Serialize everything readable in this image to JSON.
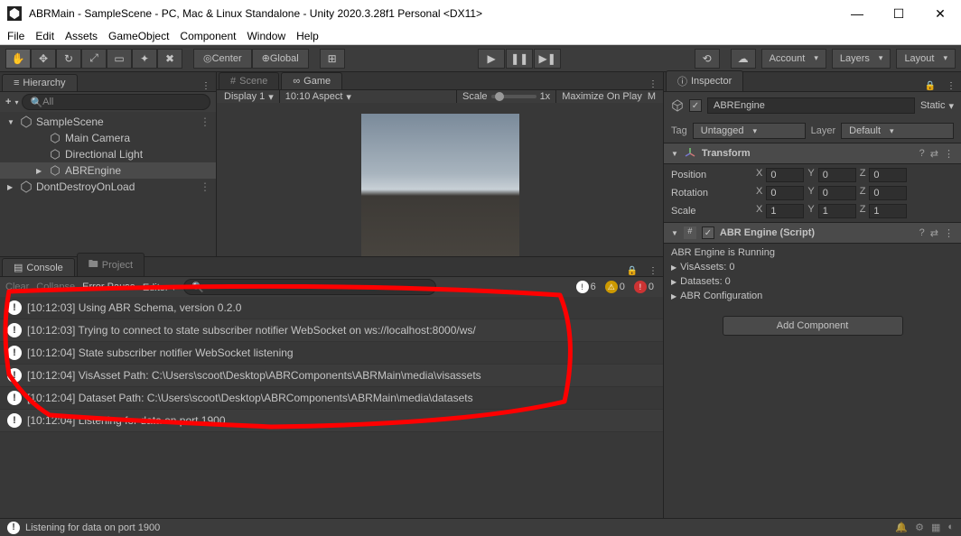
{
  "titlebar": {
    "title": "ABRMain - SampleScene - PC, Mac & Linux Standalone - Unity 2020.3.28f1 Personal <DX11>"
  },
  "menu": [
    "File",
    "Edit",
    "Assets",
    "GameObject",
    "Component",
    "Window",
    "Help"
  ],
  "toolbar": {
    "center_label": "Center",
    "global_label": "Global",
    "account_label": "Account",
    "layers_label": "Layers",
    "layout_label": "Layout"
  },
  "hierarchy": {
    "tab": "Hierarchy",
    "add_label": "+",
    "search_placeholder": "All",
    "items": [
      {
        "label": "SampleScene",
        "type": "scene",
        "expanded": true,
        "indent": 0
      },
      {
        "label": "Main Camera",
        "type": "go",
        "indent": 2
      },
      {
        "label": "Directional Light",
        "type": "go",
        "indent": 2
      },
      {
        "label": "ABREngine",
        "type": "go",
        "indent": 2,
        "selected": true,
        "hasArrow": true
      },
      {
        "label": "DontDestroyOnLoad",
        "type": "scene",
        "expanded": false,
        "indent": 0
      }
    ]
  },
  "scene_tab": "Scene",
  "game_tab": "Game",
  "game_toolbar": {
    "display": "Display 1",
    "aspect": "10:10 Aspect",
    "scale_label": "Scale",
    "scale_value": "1x",
    "maximize": "Maximize On Play",
    "mute": "M"
  },
  "console": {
    "tab": "Console",
    "project_tab": "Project",
    "clear": "Clear",
    "collapse": "Collapse",
    "error_pause": "Error Pause",
    "editor": "Editor",
    "info_count": "6",
    "warn_count": "0",
    "error_count": "0",
    "items": [
      {
        "text": "[10:12:03] Using ABR Schema, version 0.2.0"
      },
      {
        "text": "[10:12:03] Trying to connect to state subscriber notifier WebSocket on ws://localhost:8000/ws/"
      },
      {
        "text": "[10:12:04] State subscriber notifier WebSocket listening"
      },
      {
        "text": "[10:12:04] VisAsset Path: C:\\Users\\scoot\\Desktop\\ABRComponents\\ABRMain\\media\\visassets"
      },
      {
        "text": "[10:12:04] Dataset Path: C:\\Users\\scoot\\Desktop\\ABRComponents\\ABRMain\\media\\datasets"
      },
      {
        "text": "[10:12:04] Listening for data on port 1900"
      }
    ]
  },
  "inspector": {
    "tab": "Inspector",
    "name": "ABREngine",
    "static_label": "Static",
    "tag_label": "Tag",
    "tag_value": "Untagged",
    "layer_label": "Layer",
    "layer_value": "Default",
    "transform": {
      "title": "Transform",
      "position": {
        "label": "Position",
        "x": "0",
        "y": "0",
        "z": "0"
      },
      "rotation": {
        "label": "Rotation",
        "x": "0",
        "y": "0",
        "z": "0"
      },
      "scale": {
        "label": "Scale",
        "x": "1",
        "y": "1",
        "z": "1"
      }
    },
    "abr_engine": {
      "title": "ABR Engine (Script)",
      "running": "ABR Engine is Running",
      "visassets": "VisAssets: 0",
      "datasets": "Datasets: 0",
      "config": "ABR Configuration"
    },
    "add_component": "Add Component"
  },
  "statusbar": {
    "message": "Listening for data on port 1900"
  }
}
